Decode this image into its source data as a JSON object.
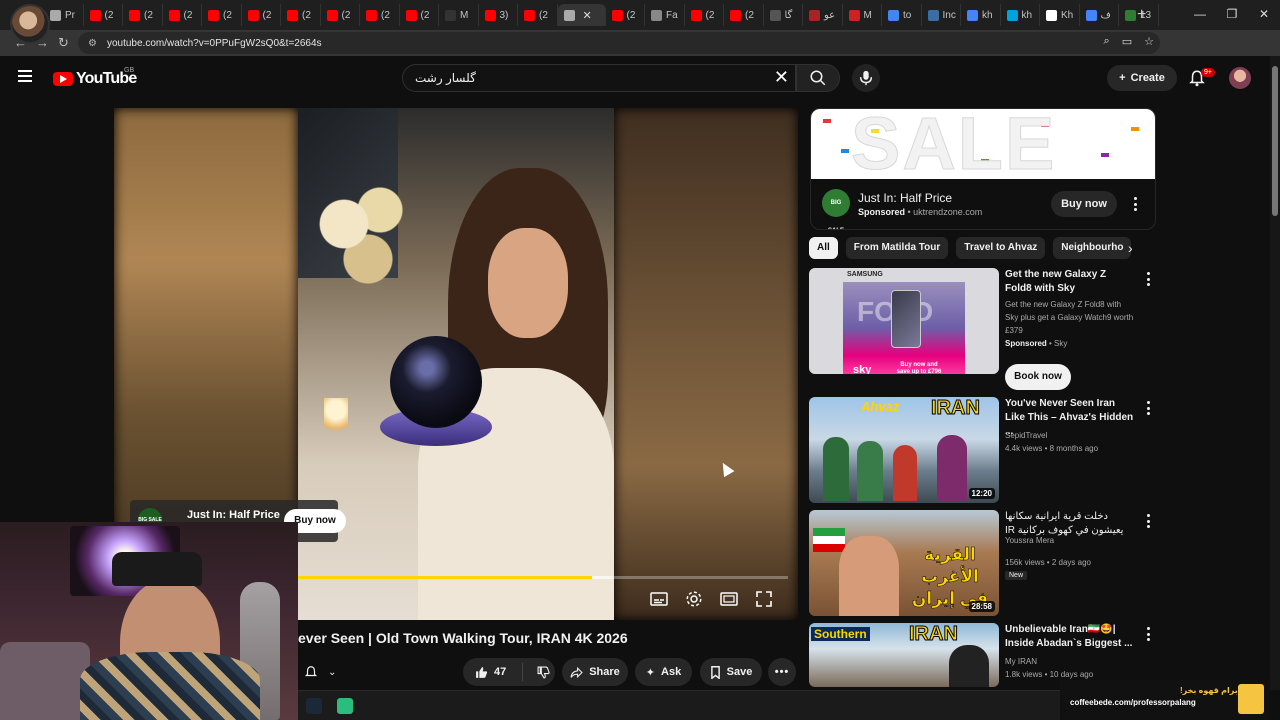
{
  "browser": {
    "tabs": [
      {
        "label": "Pr",
        "color": "#aaaaaa"
      },
      {
        "label": "(2",
        "color": "#ff0000"
      },
      {
        "label": "(2",
        "color": "#ff0000"
      },
      {
        "label": "(2",
        "color": "#ff0000"
      },
      {
        "label": "(2",
        "color": "#ff0000"
      },
      {
        "label": "(2",
        "color": "#ff0000"
      },
      {
        "label": "(2",
        "color": "#ff0000"
      },
      {
        "label": "(2",
        "color": "#ff0000"
      },
      {
        "label": "(2",
        "color": "#ff0000"
      },
      {
        "label": "(2",
        "color": "#ff0000"
      },
      {
        "label": "M",
        "color": "#333333"
      },
      {
        "label": "3)",
        "color": "#ff0000"
      },
      {
        "label": "(2",
        "color": "#ff0000"
      },
      {
        "label": "",
        "color": "#aaaaaa",
        "active": true
      },
      {
        "label": "(2",
        "color": "#ff0000"
      },
      {
        "label": "Fa",
        "color": "#888888"
      },
      {
        "label": "(2",
        "color": "#ff0000"
      },
      {
        "label": "(2",
        "color": "#ff0000"
      },
      {
        "label": "گا",
        "color": "#555555"
      },
      {
        "label": "عو",
        "color": "#aa2222"
      },
      {
        "label": "M",
        "color": "#cc2222"
      },
      {
        "label": "to",
        "color": "#4285f4"
      },
      {
        "label": "Inc",
        "color": "#3b6ea5"
      },
      {
        "label": "kh",
        "color": "#4285f4"
      },
      {
        "label": "kh",
        "color": "#00a3d9"
      },
      {
        "label": "Kh",
        "color": "#ffffff"
      },
      {
        "label": "ف",
        "color": "#4285f4"
      },
      {
        "label": "13",
        "color": "#2e7d32"
      }
    ],
    "url": "youtube.com/watch?v=0PPuFgW2sQ0&t=2664s"
  },
  "header": {
    "logo_text": "YouTube",
    "country": "GB",
    "search_value": "گلسار رشت",
    "create_label": "Create",
    "notification_count": "9+"
  },
  "player": {
    "progress_fraction": 0.6,
    "loaded_fraction": 0.64,
    "ad_overlay": {
      "badge": "BIG SALE",
      "title": "Just In: Half Price",
      "button": "Buy now"
    }
  },
  "video": {
    "title": "ever Seen | Old Town Walking Tour, IRAN 4K 2026",
    "likes": "47",
    "share_label": "Share",
    "ask_label": "Ask",
    "save_label": "Save"
  },
  "sidebar": {
    "ad": {
      "banner_text": "SALE",
      "logo": "BIG SALE",
      "title": "Just In: Half Price",
      "sponsored": "Sponsored",
      "domain": "uktrendzone.com",
      "button": "Buy now"
    },
    "chips": [
      "All",
      "From Matilda Tour",
      "Travel to Ahvaz",
      "Neighbourho"
    ],
    "recommendations": [
      {
        "title": "Get the new Galaxy Z Fold8 with Sky",
        "description": "Get the new Galaxy Z Fold8 with Sky plus get a Galaxy Watch9 worth £379",
        "sponsored": "Sponsored",
        "advertiser": "Sky",
        "button": "Book now",
        "thumb_brand": "SAMSUNG",
        "thumb_text": "FOLD",
        "thumb_offer": "Buy now and save up to £796",
        "thumb_sky": "sky"
      },
      {
        "title": "You've Never Seen Iran Like This – Ahvaz's Hidden ...",
        "channel": "SepidTravel",
        "meta": "4.4k views • 8 months ago",
        "duration": "12:20",
        "thumb_text_1": "Ahvaz",
        "thumb_text_2": "IRAN"
      },
      {
        "title": "دخلت قرية ايرانية سكانها يعيشون في كهوف بركانية IR",
        "channel": "Youssra Mera",
        "meta": "156k views • 2 days ago",
        "badge": "New",
        "duration": "28:58",
        "thumb_text": "القرية الأغرب في إيران"
      },
      {
        "title": "Unbelievable Iran🇮🇷🤩| Inside Abadan`s Biggest ...",
        "channel": "My IRAN",
        "meta": "1.8k views • 10 days ago",
        "thumb_text_1": "Southern",
        "thumb_text_2": "IRAN"
      }
    ]
  },
  "promo": {
    "line1": "برام قهوه بخر!",
    "line2": "coffeebede.com/professorpalang"
  }
}
